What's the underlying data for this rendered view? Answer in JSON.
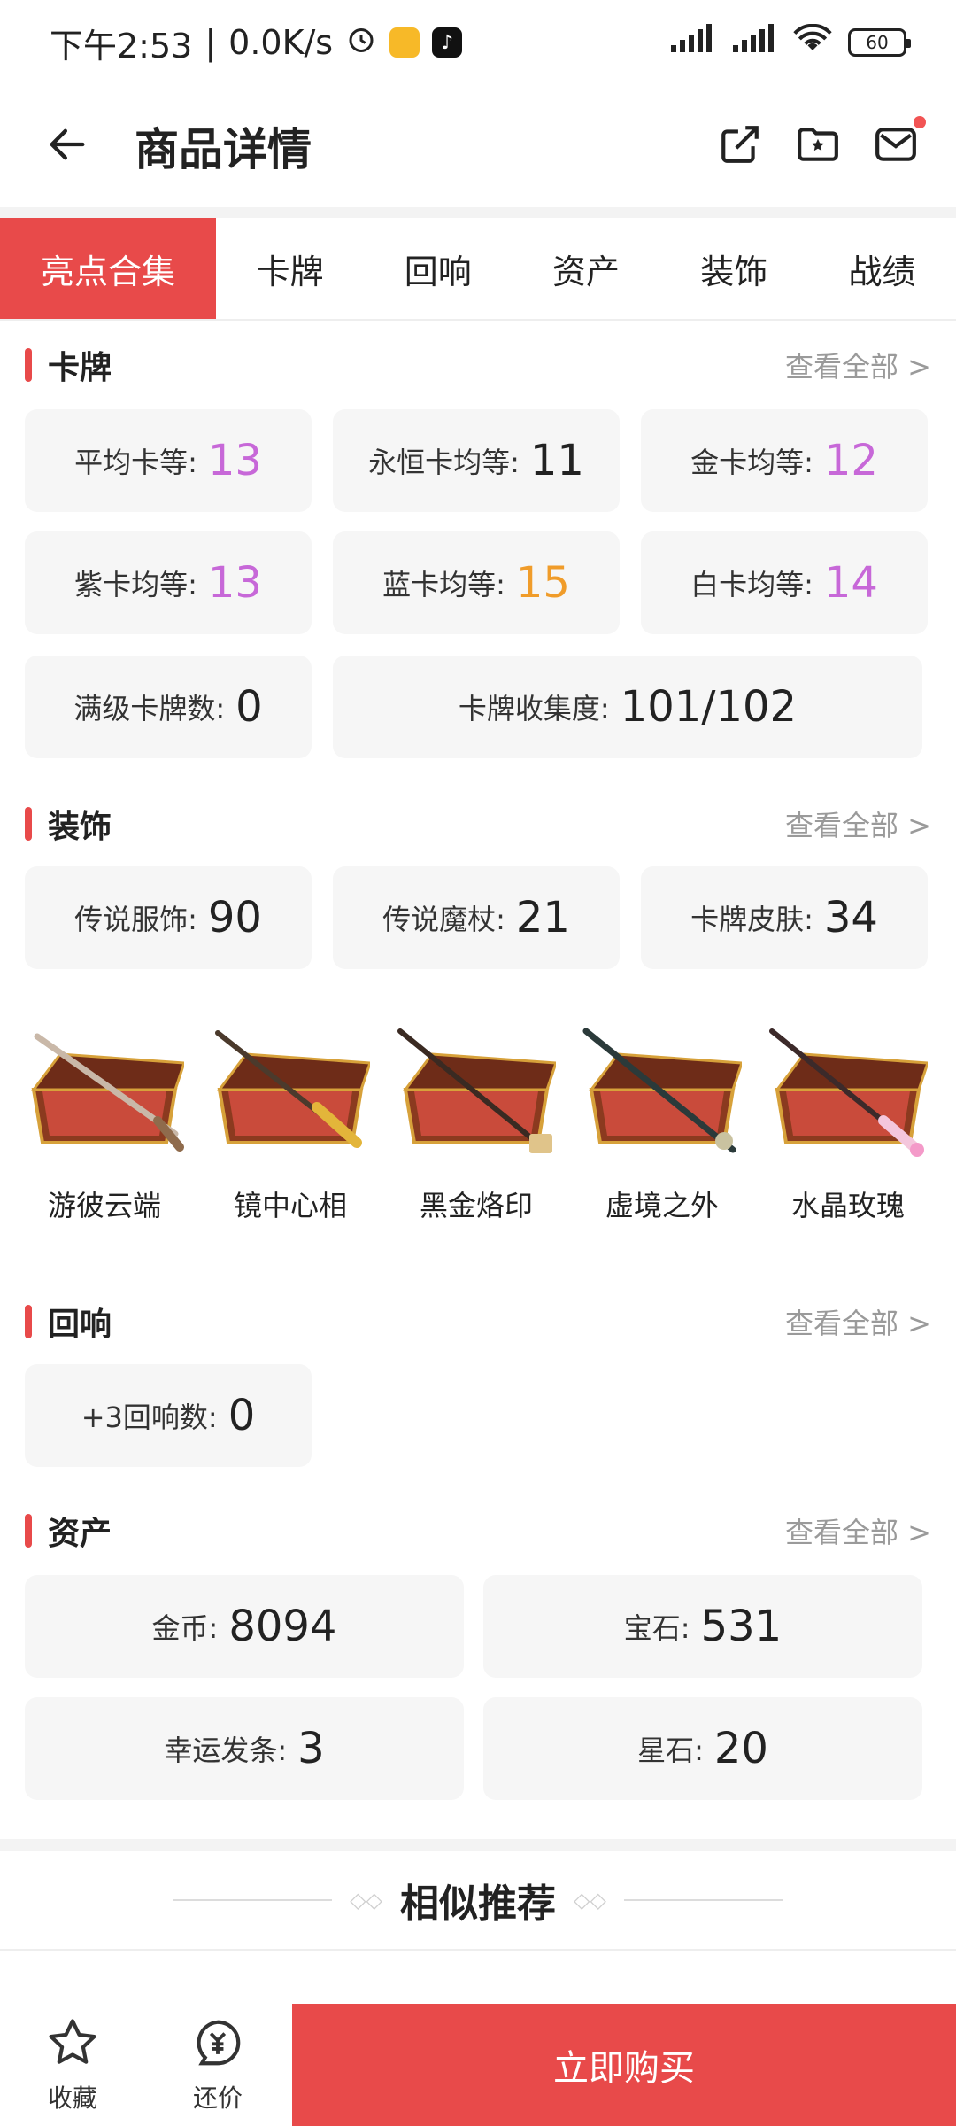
{
  "status_bar": {
    "time": "下午2:53",
    "net_speed": "0.0K/s",
    "battery": "60"
  },
  "header": {
    "title": "商品详情"
  },
  "tabs": [
    "亮点合集",
    "卡牌",
    "回响",
    "资产",
    "装饰",
    "战绩"
  ],
  "sections": {
    "cards": {
      "title": "卡牌",
      "view_all": "查看全部 >",
      "stats": [
        {
          "label": "平均卡等:",
          "value": "13",
          "color": "#c768d8"
        },
        {
          "label": "永恒卡均等:",
          "value": "11",
          "color": "#222222"
        },
        {
          "label": "金卡均等:",
          "value": "12",
          "color": "#c768d8"
        },
        {
          "label": "紫卡均等:",
          "value": "13",
          "color": "#c768d8"
        },
        {
          "label": "蓝卡均等:",
          "value": "15",
          "color": "#f09c2a"
        },
        {
          "label": "白卡均等:",
          "value": "14",
          "color": "#c768d8"
        },
        {
          "label": "满级卡牌数:",
          "value": "0",
          "color": "#222222"
        },
        {
          "label": "卡牌收集度:",
          "value": "101/102",
          "color": "#222222"
        }
      ]
    },
    "decor": {
      "title": "装饰",
      "view_all": "查看全部 >",
      "stats": [
        {
          "label": "传说服饰:",
          "value": "90"
        },
        {
          "label": "传说魔杖:",
          "value": "21"
        },
        {
          "label": "卡牌皮肤:",
          "value": "34"
        }
      ],
      "items": [
        {
          "name": "游彼云端",
          "icon": "wand-box-icon"
        },
        {
          "name": "镜中心相",
          "icon": "wand-box-icon"
        },
        {
          "name": "黑金烙印",
          "icon": "wand-box-icon"
        },
        {
          "name": "虚境之外",
          "icon": "wand-box-icon"
        },
        {
          "name": "水晶玫瑰",
          "icon": "wand-box-icon"
        }
      ]
    },
    "echo": {
      "title": "回响",
      "view_all": "查看全部 >",
      "stats": [
        {
          "label": "+3回响数:",
          "value": "0"
        }
      ]
    },
    "assets": {
      "title": "资产",
      "view_all": "查看全部 >",
      "stats": [
        {
          "label": "金币:",
          "value": "8094"
        },
        {
          "label": "宝石:",
          "value": "531"
        },
        {
          "label": "幸运发条:",
          "value": "3"
        },
        {
          "label": "星石:",
          "value": "20"
        }
      ]
    }
  },
  "similar": {
    "title": "相似推荐"
  },
  "bottom_bar": {
    "favorite": "收藏",
    "bargain": "还价",
    "buy": "立即购买"
  },
  "colors": {
    "accent": "#e84a4a",
    "purple": "#c768d8",
    "orange": "#f09c2a"
  }
}
